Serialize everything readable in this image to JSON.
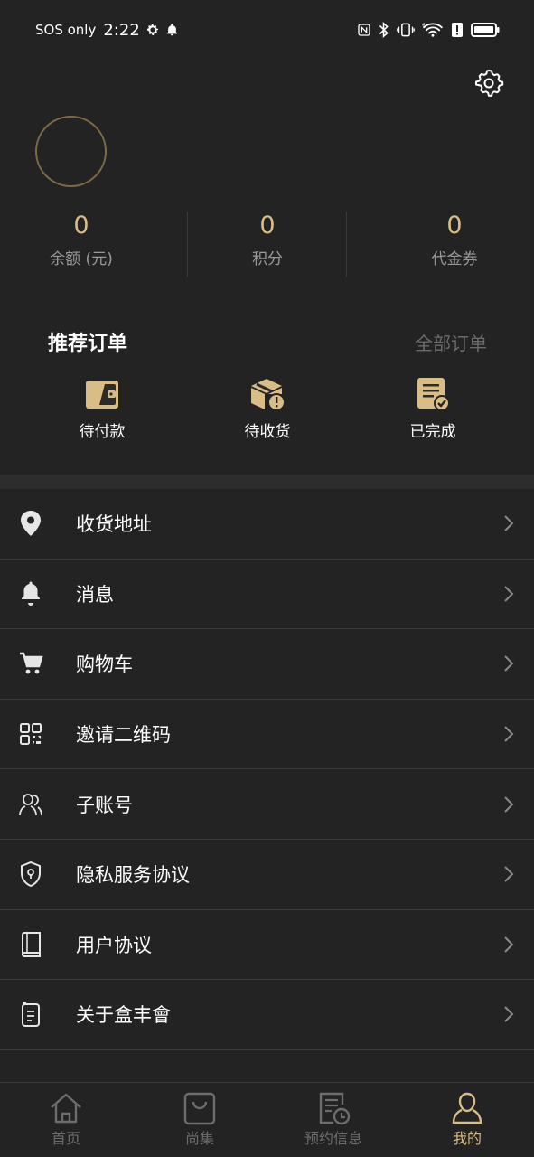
{
  "status_bar": {
    "carrier": "SOS only",
    "time": "2:22"
  },
  "profile": {
    "stats": [
      {
        "value": "0",
        "label": "余额 (元)"
      },
      {
        "value": "0",
        "label": "积分"
      },
      {
        "value": "0",
        "label": "代金券"
      }
    ]
  },
  "orders": {
    "title": "推荐订单",
    "all_label": "全部订单",
    "items": [
      {
        "label": "待付款",
        "icon": "wallet-icon"
      },
      {
        "label": "待收货",
        "icon": "package-icon"
      },
      {
        "label": "已完成",
        "icon": "completed-order-icon"
      }
    ]
  },
  "menu": {
    "items": [
      {
        "label": "收货地址",
        "icon": "location-pin-icon"
      },
      {
        "label": "消息",
        "icon": "bell-icon"
      },
      {
        "label": "购物车",
        "icon": "cart-icon"
      },
      {
        "label": "邀请二维码",
        "icon": "qr-code-icon"
      },
      {
        "label": "子账号",
        "icon": "users-icon"
      },
      {
        "label": "隐私服务协议",
        "icon": "shield-icon"
      },
      {
        "label": "用户协议",
        "icon": "book-icon"
      },
      {
        "label": "关于盒丰會",
        "icon": "info-list-icon"
      }
    ]
  },
  "tab_bar": {
    "tabs": [
      {
        "label": "首页",
        "icon": "home-icon",
        "active": false
      },
      {
        "label": "尚集",
        "icon": "bag-icon",
        "active": false
      },
      {
        "label": "预约信息",
        "icon": "appointment-icon",
        "active": false
      },
      {
        "label": "我的",
        "icon": "profile-icon",
        "active": true
      }
    ]
  },
  "colors": {
    "background": "#232323",
    "accent_gold": "#d8bd86",
    "muted_text": "#9a9a9a"
  }
}
